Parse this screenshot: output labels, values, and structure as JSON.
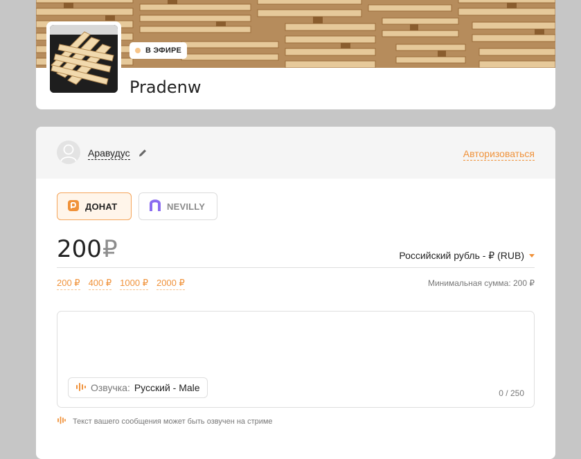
{
  "profile": {
    "live_label": "В ЭФИРЕ",
    "channel_name": "Pradenw"
  },
  "user": {
    "name": "Аравудус",
    "login_label": "Авторизоваться"
  },
  "tabs": [
    {
      "label": "ДОНАТ",
      "icon": "donat-icon",
      "active": true
    },
    {
      "label": "NEVILLY",
      "icon": "nevilly-icon",
      "active": false
    }
  ],
  "amount": {
    "value": "200",
    "currency_symbol": "₽",
    "currency_select": "Российский рубль - ₽ (RUB)",
    "presets": [
      "200 ₽",
      "400 ₽",
      "1000 ₽",
      "2000 ₽"
    ],
    "min_sum": "Минимальная сумма: 200 ₽"
  },
  "message": {
    "voice_label": "Озвучка:",
    "voice_value": "Русский - Male",
    "counter": "0 / 250",
    "hint": "Текст вашего сообщения может быть озвучен на стриме"
  },
  "colors": {
    "accent": "#f0923a",
    "nevilly": "#8b6cf0",
    "page_background": "#c6c6c6"
  }
}
